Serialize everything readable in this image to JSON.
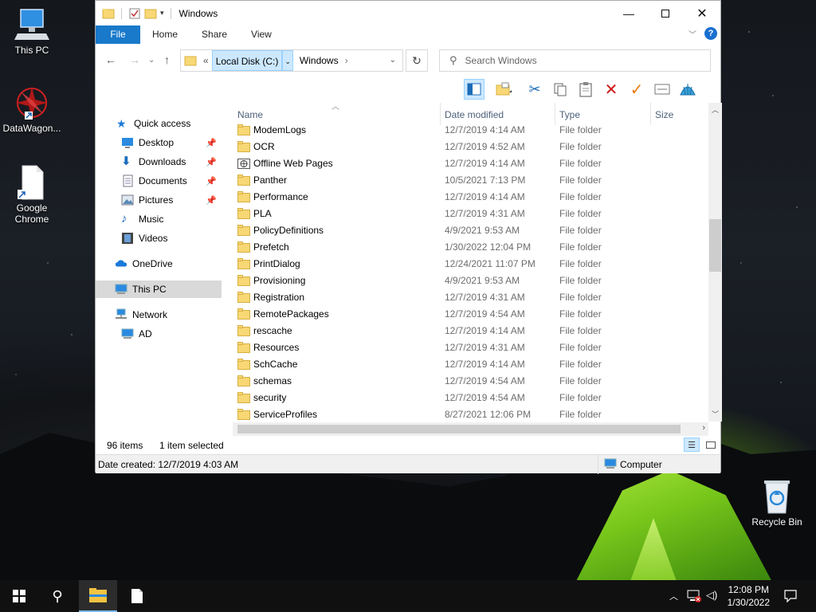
{
  "desktop": {
    "icons": [
      {
        "label_1": "This PC",
        "label_2": ""
      },
      {
        "label_1": "DataWagon...",
        "label_2": ""
      },
      {
        "label_1": "Google",
        "label_2": "Chrome"
      },
      {
        "label_1": "Recycle Bin",
        "label_2": ""
      }
    ]
  },
  "window": {
    "title": "Windows",
    "ribbon_tabs": [
      "File",
      "Home",
      "Share",
      "View"
    ],
    "help": "?",
    "address": {
      "overflow": "«",
      "segments": [
        "Local Disk (C:)",
        "Windows"
      ]
    },
    "search_placeholder": "Search Windows",
    "nav_pane": {
      "quick_access": "Quick access",
      "items": [
        "Desktop",
        "Downloads",
        "Documents",
        "Pictures",
        "Music",
        "Videos"
      ],
      "onedrive": "OneDrive",
      "this_pc": "This PC",
      "network": "Network",
      "ad": "AD"
    },
    "columns": [
      "Name",
      "Date modified",
      "Type",
      "Size"
    ],
    "files": [
      {
        "name": "ModemLogs",
        "date": "12/7/2019 4:14 AM",
        "type": "File folder",
        "icon": "folder-icon"
      },
      {
        "name": "OCR",
        "date": "12/7/2019 4:52 AM",
        "type": "File folder",
        "icon": "folder-icon"
      },
      {
        "name": "Offline Web Pages",
        "date": "12/7/2019 4:14 AM",
        "type": "File folder",
        "icon": "offline-web-folder-icon"
      },
      {
        "name": "Panther",
        "date": "10/5/2021 7:13 PM",
        "type": "File folder",
        "icon": "folder-icon"
      },
      {
        "name": "Performance",
        "date": "12/7/2019 4:14 AM",
        "type": "File folder",
        "icon": "folder-icon"
      },
      {
        "name": "PLA",
        "date": "12/7/2019 4:31 AM",
        "type": "File folder",
        "icon": "folder-icon"
      },
      {
        "name": "PolicyDefinitions",
        "date": "4/9/2021 9:53 AM",
        "type": "File folder",
        "icon": "folder-icon"
      },
      {
        "name": "Prefetch",
        "date": "1/30/2022 12:04 PM",
        "type": "File folder",
        "icon": "folder-icon"
      },
      {
        "name": "PrintDialog",
        "date": "12/24/2021 11:07 PM",
        "type": "File folder",
        "icon": "folder-icon"
      },
      {
        "name": "Provisioning",
        "date": "4/9/2021 9:53 AM",
        "type": "File folder",
        "icon": "folder-icon"
      },
      {
        "name": "Registration",
        "date": "12/7/2019 4:31 AM",
        "type": "File folder",
        "icon": "folder-icon"
      },
      {
        "name": "RemotePackages",
        "date": "12/7/2019 4:54 AM",
        "type": "File folder",
        "icon": "folder-icon"
      },
      {
        "name": "rescache",
        "date": "12/7/2019 4:14 AM",
        "type": "File folder",
        "icon": "folder-icon"
      },
      {
        "name": "Resources",
        "date": "12/7/2019 4:31 AM",
        "type": "File folder",
        "icon": "folder-icon"
      },
      {
        "name": "SchCache",
        "date": "12/7/2019 4:14 AM",
        "type": "File folder",
        "icon": "folder-icon"
      },
      {
        "name": "schemas",
        "date": "12/7/2019 4:54 AM",
        "type": "File folder",
        "icon": "folder-icon"
      },
      {
        "name": "security",
        "date": "12/7/2019 4:54 AM",
        "type": "File folder",
        "icon": "folder-icon"
      },
      {
        "name": "ServiceProfiles",
        "date": "8/27/2021 12:06 PM",
        "type": "File folder",
        "icon": "folder-icon"
      }
    ],
    "status": {
      "item_count": "96 items",
      "selected": "1 item selected"
    },
    "details": {
      "date_created": "Date created: 12/7/2019 4:03 AM",
      "location": "Computer"
    }
  },
  "taskbar": {
    "time": "12:08 PM",
    "date": "1/30/2022"
  },
  "colors": {
    "file_tab": "#1979ca",
    "selection": "#cce8ff",
    "folder": "#f8d775"
  }
}
